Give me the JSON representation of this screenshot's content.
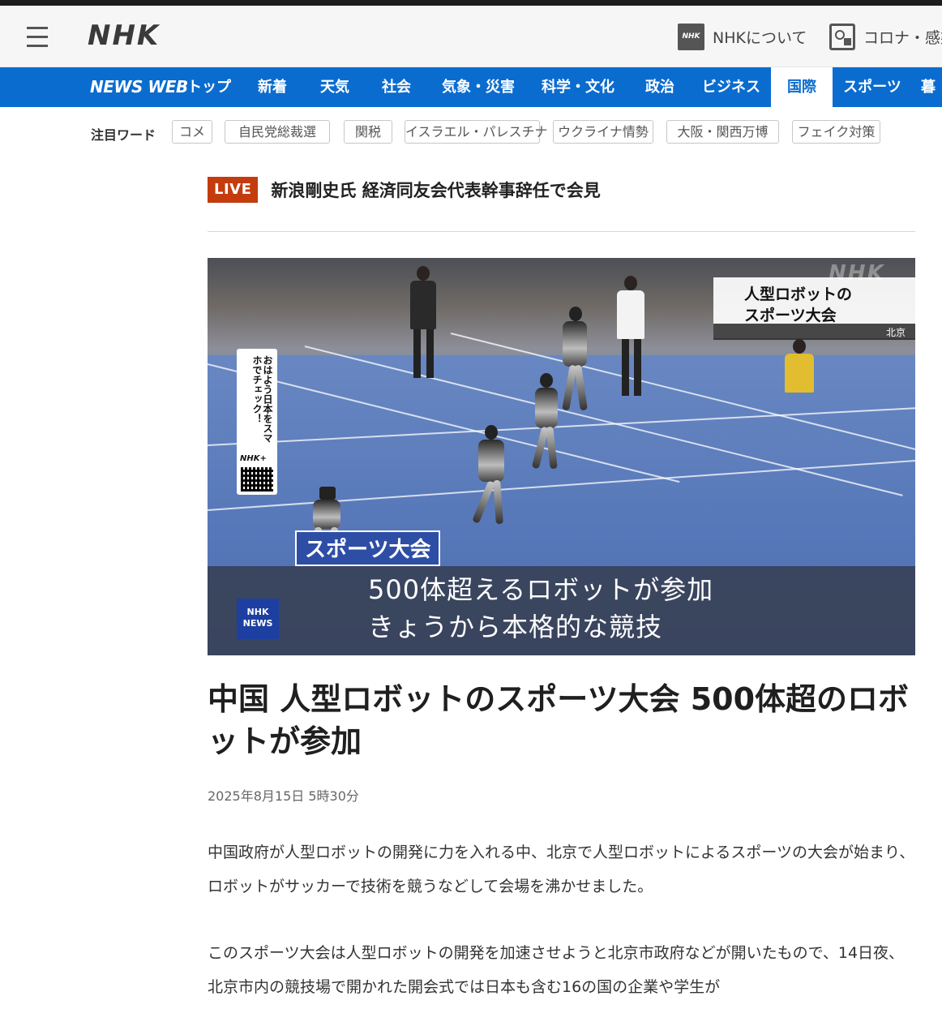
{
  "header": {
    "logo": "NHK",
    "about_badge": "NHK",
    "about_label": "NHKについて",
    "covid_label": "コロナ・感染"
  },
  "nav": {
    "brand": "NEWS WEB",
    "items": [
      {
        "label": "トップ"
      },
      {
        "label": "新着"
      },
      {
        "label": "天気"
      },
      {
        "label": "社会"
      },
      {
        "label": "気象・災害"
      },
      {
        "label": "科学・文化"
      },
      {
        "label": "政治"
      },
      {
        "label": "ビジネス"
      },
      {
        "label": "国際",
        "active": true
      },
      {
        "label": "スポーツ"
      },
      {
        "label": "暮"
      }
    ]
  },
  "trending": {
    "label": "注目ワード",
    "chips": [
      "コメ",
      "自民党総裁選",
      "関税",
      "イスラエル・パレスチナ",
      "ウクライナ情勢",
      "大阪・関西万博",
      "フェイク対策"
    ]
  },
  "live": {
    "badge": "LIVE",
    "title": "新浪剛史氏 経済同友会代表幹事辞任で会見"
  },
  "hero": {
    "watermark": "NHK",
    "tag_line1": "人型ロボットの",
    "tag_line2": "スポーツ大会",
    "place": "北京",
    "qr_text": "おはよう日本をスマホでチェック！",
    "qr_brand": "NHK+",
    "caption_label": "スポーツ大会",
    "caption_line1": "500体超えるロボットが参加",
    "caption_line2": "きょうから本格的な競技",
    "news_badge_1": "NHK",
    "news_badge_2": "NEWS"
  },
  "article": {
    "title": "中国 人型ロボットのスポーツ大会 500体超のロボットが参加",
    "date": "2025年8月15日 5時30分",
    "paragraph1": "中国政府が人型ロボットの開発に力を入れる中、北京で人型ロボットによるスポーツの大会が始まり、ロボットがサッカーで技術を競うなどして会場を沸かせました。",
    "paragraph2": "このスポーツ大会は人型ロボットの開発を加速させようと北京市政府などが開いたもので、14日夜、北京市内の競技場で開かれた開会式では日本も含む16の国の企業や学生が"
  }
}
